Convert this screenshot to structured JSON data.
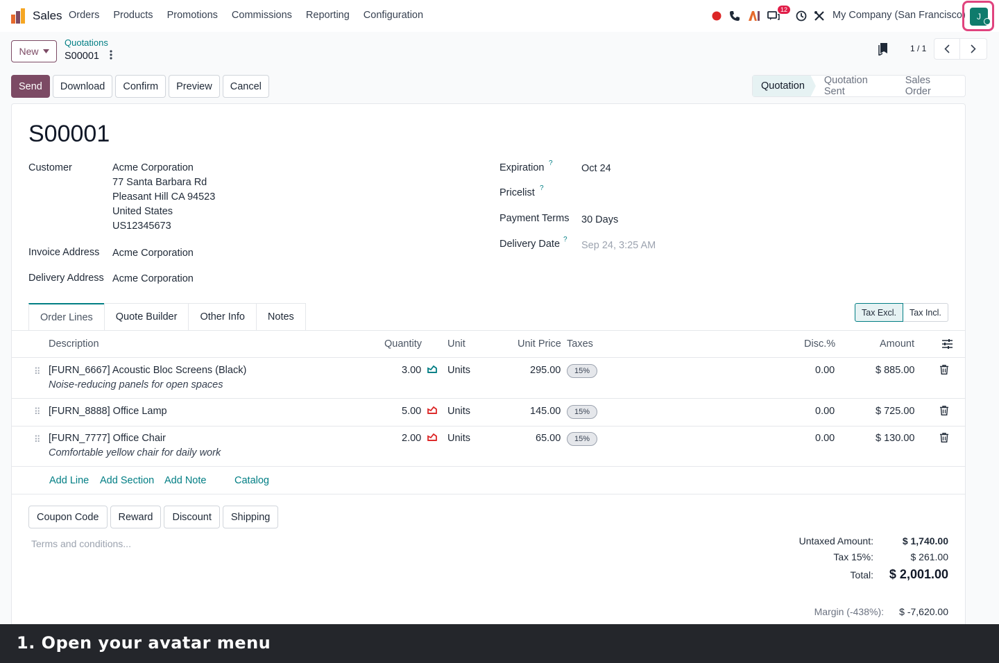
{
  "nav": {
    "app_name": "Sales",
    "menu": [
      "Orders",
      "Products",
      "Promotions",
      "Commissions",
      "Reporting",
      "Configuration"
    ],
    "chat_badge": "12",
    "company": "My Company (San Francisco)",
    "avatar_initial": "J"
  },
  "control": {
    "new_label": "New",
    "breadcrumb_parent": "Quotations",
    "breadcrumb_current": "S00001",
    "pager_value": "1 / 1"
  },
  "actions": [
    "Send",
    "Download",
    "Confirm",
    "Preview",
    "Cancel"
  ],
  "statusbar": [
    "Quotation",
    "Quotation Sent",
    "Sales Order"
  ],
  "form": {
    "title": "S00001",
    "customer_label": "Customer",
    "customer_lines": [
      "Acme Corporation",
      "77 Santa Barbara Rd",
      "Pleasant Hill CA 94523",
      "United States",
      "US12345673"
    ],
    "invoice_label": "Invoice Address",
    "invoice_value": "Acme Corporation",
    "delivery_addr_label": "Delivery Address",
    "delivery_addr_value": "Acme Corporation",
    "expiration_label": "Expiration",
    "expiration_value": "Oct 24",
    "pricelist_label": "Pricelist",
    "payment_terms_label": "Payment Terms",
    "payment_terms_value": "30 Days",
    "delivery_date_label": "Delivery Date",
    "delivery_date_placeholder": "Sep 24, 3:25 AM",
    "help_mark": "?"
  },
  "tabs": [
    "Order Lines",
    "Quote Builder",
    "Other Info",
    "Notes"
  ],
  "tax_toggle": [
    "Tax Excl.",
    "Tax Incl."
  ],
  "columns": {
    "description": "Description",
    "quantity": "Quantity",
    "unit": "Unit",
    "unit_price": "Unit Price",
    "taxes": "Taxes",
    "discount": "Disc.%",
    "amount": "Amount"
  },
  "lines": [
    {
      "product": "[FURN_6667] Acoustic Bloc Screens (Black)",
      "note": "Noise-reducing panels for open spaces",
      "qty": "3.00",
      "unit": "Units",
      "price": "295.00",
      "tax": "15%",
      "disc": "0.00",
      "amount": "$ 885.00",
      "forecast_color": "#017e84"
    },
    {
      "product": "[FURN_8888] Office Lamp",
      "note": "",
      "qty": "5.00",
      "unit": "Units",
      "price": "145.00",
      "tax": "15%",
      "disc": "0.00",
      "amount": "$ 725.00",
      "forecast_color": "#dc2626"
    },
    {
      "product": "[FURN_7777] Office Chair",
      "note": "Comfortable yellow chair for daily work",
      "qty": "2.00",
      "unit": "Units",
      "price": "65.00",
      "tax": "15%",
      "disc": "0.00",
      "amount": "$ 130.00",
      "forecast_color": "#dc2626"
    }
  ],
  "add_links": [
    "Add Line",
    "Add Section",
    "Add Note",
    "Catalog"
  ],
  "promo_buttons": [
    "Coupon Code",
    "Reward",
    "Discount",
    "Shipping"
  ],
  "terms_placeholder": "Terms and conditions...",
  "totals": {
    "untaxed_label": "Untaxed Amount:",
    "untaxed_value": "$ 1,740.00",
    "tax_label": "Tax 15%:",
    "tax_value": "$ 261.00",
    "total_label": "Total:",
    "total_value": "$ 2,001.00",
    "margin_label": "Margin (-438%):",
    "margin_value": "$ -7,620.00"
  },
  "tutorial_caption": "1. Open your avatar menu",
  "colors": {
    "primary": "#7c4a64",
    "accent": "#017e84",
    "highlight": "#e0437e"
  }
}
